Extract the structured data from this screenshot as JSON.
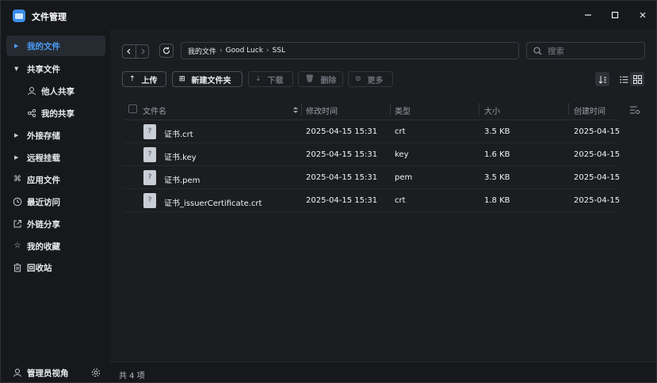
{
  "window": {
    "title": "文件管理",
    "controls": [
      "minimize",
      "maximize",
      "close"
    ]
  },
  "sidebar": {
    "items": [
      {
        "label": "我的文件",
        "icon": "caret-right-icon",
        "active": true
      },
      {
        "label": "共享文件",
        "icon": "caret-down-icon"
      },
      {
        "label": "他人共享",
        "icon": "user-icon",
        "sub": true
      },
      {
        "label": "我的共享",
        "icon": "share-icon",
        "sub": true
      },
      {
        "label": "外接存储",
        "icon": "caret-right-icon"
      },
      {
        "label": "远程挂载",
        "icon": "caret-right-icon"
      },
      {
        "label": "应用文件",
        "icon": "command-icon"
      },
      {
        "label": "最近访问",
        "icon": "clock-icon"
      },
      {
        "label": "外链分享",
        "icon": "external-link-icon"
      },
      {
        "label": "我的收藏",
        "icon": "star-icon"
      },
      {
        "label": "回收站",
        "icon": "trash-icon"
      }
    ],
    "footer": {
      "label": "管理员视角",
      "settings_icon": "gear-icon"
    }
  },
  "path": {
    "crumbs": [
      "我的文件",
      "Good Luck",
      "SSL"
    ],
    "separator": "›"
  },
  "search": {
    "placeholder": "搜索"
  },
  "toolbar": {
    "upload": "上传",
    "new_folder": "新建文件夹",
    "download": "下载",
    "delete": "删除",
    "more": "更多"
  },
  "table": {
    "headers": {
      "name": "文件名",
      "modified": "修改时间",
      "type": "类型",
      "size": "大小",
      "created": "创建时间"
    },
    "rows": [
      {
        "name": "证书.crt",
        "modified": "2025-04-15 15:31",
        "type": "crt",
        "size": "3.5 KB",
        "created": "2025-04-15"
      },
      {
        "name": "证书.key",
        "modified": "2025-04-15 15:31",
        "type": "key",
        "size": "1.6 KB",
        "created": "2025-04-15"
      },
      {
        "name": "证书.pem",
        "modified": "2025-04-15 15:31",
        "type": "pem",
        "size": "3.5 KB",
        "created": "2025-04-15"
      },
      {
        "name": "证书_issuerCertificate.crt",
        "modified": "2025-04-15 15:31",
        "type": "crt",
        "size": "1.8 KB",
        "created": "2025-04-15"
      }
    ]
  },
  "status": {
    "count_text": "共 4 项"
  },
  "colors": {
    "accent": "#4a9df8",
    "background": "#1b1d21",
    "sidebar": "#16181c"
  }
}
